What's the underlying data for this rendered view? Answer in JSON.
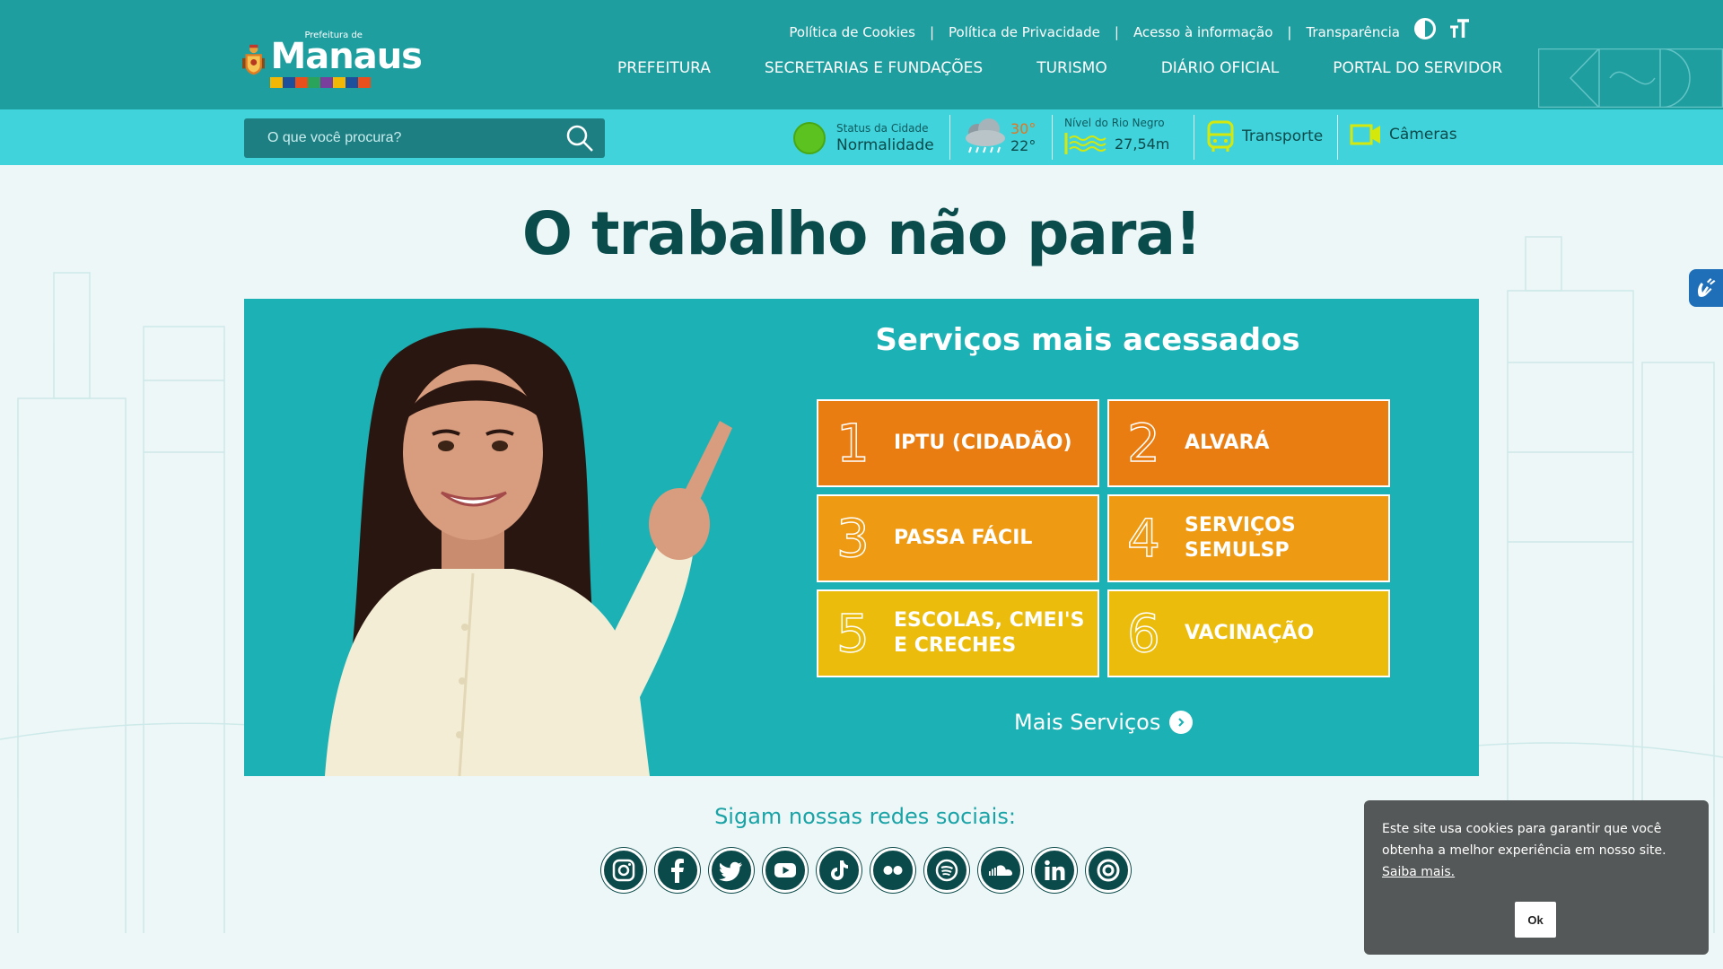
{
  "header": {
    "logo": {
      "subtitle": "Prefeitura de",
      "name": "Manaus"
    },
    "utility_links": [
      "Política de Cookies",
      "Política de Privacidade",
      "Acesso à informação",
      "Transparência"
    ],
    "separator": "|",
    "font_size_icon_label": "T",
    "nav": [
      "PREFEITURA",
      "SECRETARIAS E FUNDAÇÕES",
      "TURISMO",
      "DIÁRIO OFICIAL",
      "PORTAL DO SERVIDOR"
    ]
  },
  "infobar": {
    "search_placeholder": "O que você procura?",
    "status": {
      "label": "Status da Cidade",
      "value": "Normalidade",
      "color": "#5cc21f"
    },
    "weather": {
      "max": "30°",
      "min": "22°",
      "icon": "rain-cloud-icon"
    },
    "river": {
      "label": "Nível do Rio Negro",
      "value": "27,54m"
    },
    "transport": "Transporte",
    "cameras": "Câmeras"
  },
  "hero": {
    "title": "O trabalho não para!",
    "services_title": "Serviços mais acessados",
    "services": [
      {
        "num": "1",
        "label": "IPTU (CIDADÃO)",
        "color": "#ea7d12"
      },
      {
        "num": "2",
        "label": "ALVARÁ",
        "color": "#ea7d12"
      },
      {
        "num": "3",
        "label": "PASSA FÁCIL",
        "color": "#ee9a12"
      },
      {
        "num": "4",
        "label": "SERVIÇOS\nSEMULSP",
        "color": "#ee9a12"
      },
      {
        "num": "5",
        "label": "ESCOLAS, CMEI'S\nE CRECHES",
        "color": "#ebbc0c"
      },
      {
        "num": "6",
        "label": "VACINAÇÃO",
        "color": "#ebbc0c"
      }
    ],
    "more_services": "Mais Serviços"
  },
  "social": {
    "title": "Sigam nossas redes sociais:",
    "networks": [
      "instagram",
      "facebook",
      "twitter",
      "youtube",
      "tiktok",
      "flickr",
      "spotify",
      "soundcloud",
      "linkedin",
      "radio"
    ]
  },
  "cookie": {
    "text": "Este site usa cookies para garantir que você obtenha a melhor experiência em nosso site.",
    "link": "Saiba mais.",
    "ok": "Ok"
  },
  "colors": {
    "header_bg": "#1f9ea0",
    "infobar_bg": "#40d3dc",
    "panel_bg": "#1cb1b4",
    "title_color": "#0a4b4c"
  }
}
